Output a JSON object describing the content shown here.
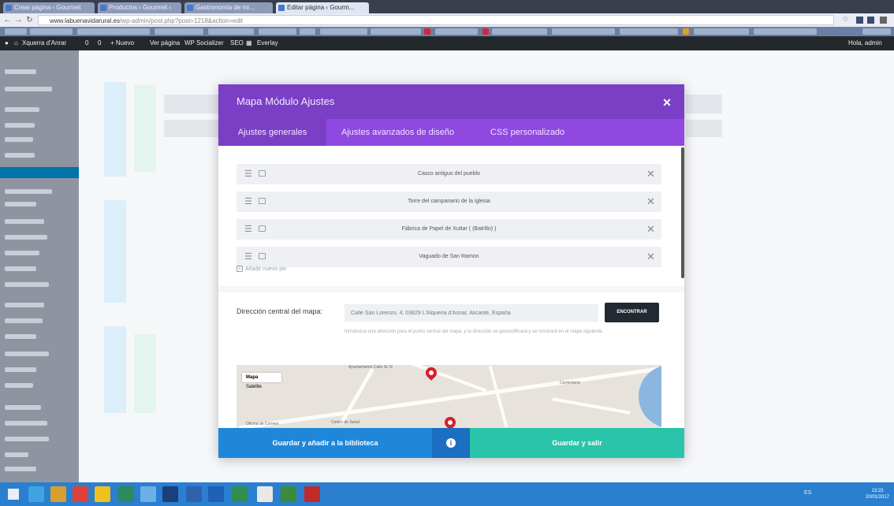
{
  "browser": {
    "tabs": [
      {
        "label": "Crear página ‹ Gourmet"
      },
      {
        "label": "Productos ‹ Gourmet ‹"
      },
      {
        "label": "Gastronomía de mi..."
      },
      {
        "label": "Editar página ‹ Gourm..."
      }
    ],
    "url_host": "www.labuenavidarural.es",
    "url_path": "/wp-admin/post.php?post=1218&action=edit"
  },
  "wp_admin_bar": {
    "site": "Xquerra d'Anrar",
    "updates": "0",
    "comments": "0",
    "new": "+ Nuevo",
    "page": "Ver página",
    "plugin": "WP Socializer",
    "seo": "SEO",
    "builder": "Everlay",
    "user": "Hola, admin"
  },
  "modal": {
    "title": "Mapa Módulo Ajustes",
    "close_icon": "close-icon",
    "tabs": [
      {
        "label": "Ajustes generales",
        "active": true
      },
      {
        "label": "Ajustes avanzados de diseño",
        "active": false
      },
      {
        "label": "CSS personalizado",
        "active": false
      }
    ],
    "items": [
      {
        "label": "Casco antiguo del pueblo"
      },
      {
        "label": "Torre del campanario de la iglesia"
      },
      {
        "label": "Fábrica de Papel de Xuttar ( (Batrillo) )"
      },
      {
        "label": "Vaguado de San Ramon"
      }
    ],
    "add_item": "Añadir nuevo pin",
    "address_label": "Dirección central del mapa:",
    "address_value": "Calle San Lorenzo, 4, 03829 L'Alqueria d'Asnar, Alicante, España",
    "find_button": "ENCONTRAR",
    "help_text": "Introduzca una dirección para el punto central del mapa, y la dirección se geocodificará y se mostrará en el mapa siguiente.",
    "map": {
      "toggle": [
        "Mapa",
        "Satélite"
      ],
      "labels": [
        "Ayuntamiento Calle Sr. N",
        "Oficina de Correos",
        "Centro de Salud",
        "Cementerio"
      ]
    },
    "footer": {
      "save_library": "Guardar y añadir a la biblioteca",
      "info_icon": "info-icon",
      "save_exit": "Guardar y salir"
    }
  },
  "colors": {
    "modal_header": "#7b3fc6",
    "modal_tabs": "#8f48e0",
    "save_library": "#1f87d9",
    "save_exit": "#29c4a9",
    "taskbar": "#2a7fd0"
  },
  "taskbar": {
    "tray": "ES",
    "time": "13:23",
    "date": "20/01/2017"
  }
}
